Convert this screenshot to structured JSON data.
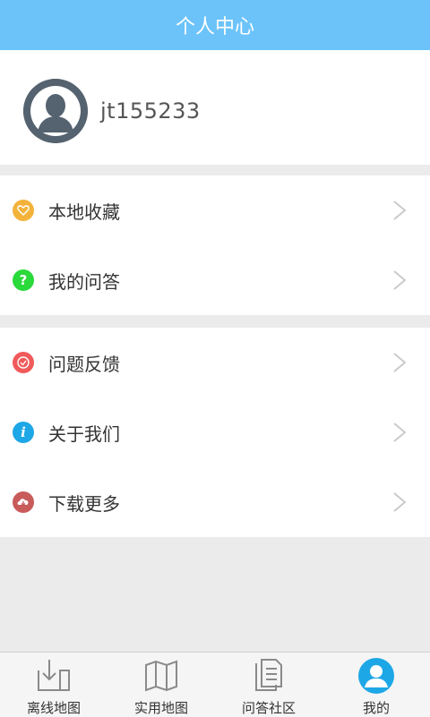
{
  "header": {
    "title": "个人中心"
  },
  "profile": {
    "username": "jt155233"
  },
  "menu_group_1": [
    {
      "label": "本地收藏",
      "icon": "heart-icon",
      "color": "#f3b33b"
    },
    {
      "label": "我的问答",
      "icon": "question-icon",
      "color": "#2ad93a"
    }
  ],
  "menu_group_2": [
    {
      "label": "问题反馈",
      "icon": "feedback-icon",
      "color": "#f05a5a"
    },
    {
      "label": "关于我们",
      "icon": "info-icon",
      "color": "#1ea7e6"
    },
    {
      "label": "下载更多",
      "icon": "download-cloud-icon",
      "color": "#c95b5b"
    }
  ],
  "tabs": [
    {
      "label": "离线地图",
      "icon": "offline-map-icon",
      "active": false
    },
    {
      "label": "实用地图",
      "icon": "map-icon",
      "active": false
    },
    {
      "label": "问答社区",
      "icon": "document-icon",
      "active": false
    },
    {
      "label": "我的",
      "icon": "profile-icon",
      "active": true
    }
  ],
  "colors": {
    "header": "#6cc3fa",
    "accent": "#1ea7e6",
    "background": "#ebebeb"
  }
}
